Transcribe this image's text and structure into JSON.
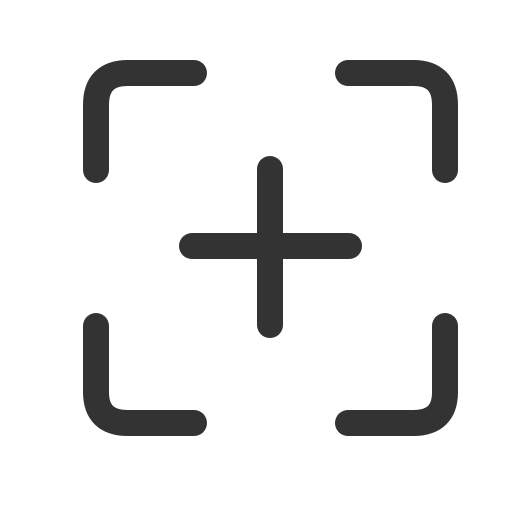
{
  "icon": {
    "name": "add-frame-icon",
    "stroke_color": "#333333",
    "background": "#ffffff"
  }
}
